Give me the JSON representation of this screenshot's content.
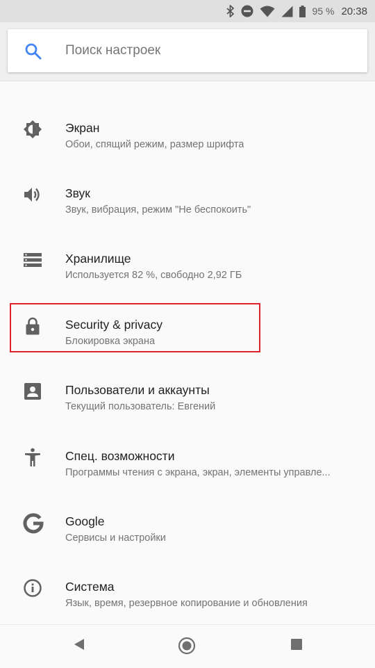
{
  "status_bar": {
    "icons": [
      "bluetooth-icon",
      "do-not-disturb-icon",
      "wifi-icon",
      "signal-icon"
    ],
    "battery": "95 %",
    "time": "20:38"
  },
  "search": {
    "placeholder": "Поиск настроек",
    "icon": "search-icon",
    "accent": "#4285f4"
  },
  "settings": [
    {
      "icon": "brightness-icon",
      "title": "Экран",
      "subtitle": "Обои, спящий режим, размер шрифта"
    },
    {
      "icon": "volume-icon",
      "title": "Звук",
      "subtitle": "Звук, вибрация, режим \"Не беспокоить\""
    },
    {
      "icon": "storage-icon",
      "title": "Хранилище",
      "subtitle": "Используется 82 %, свободно 2,92 ГБ"
    },
    {
      "icon": "lock-icon",
      "title": "Security & privacy",
      "subtitle": "Блокировка экрана"
    },
    {
      "icon": "account-box-icon",
      "title": "Пользователи и аккаунты",
      "subtitle": "Текущий пользователь: Евгений"
    },
    {
      "icon": "accessibility-icon",
      "title": "Спец. возможности",
      "subtitle": "Программы чтения с экрана, экран, элементы управле..."
    },
    {
      "icon": "google-icon",
      "title": "Google",
      "subtitle": "Сервисы и настройки"
    },
    {
      "icon": "info-icon",
      "title": "Система",
      "subtitle": "Язык, время, резервное копирование и обновления"
    }
  ],
  "highlight": {
    "target": "Security & privacy",
    "color": "#e0202a"
  },
  "nav": [
    "back-icon",
    "home-icon",
    "recents-icon"
  ]
}
